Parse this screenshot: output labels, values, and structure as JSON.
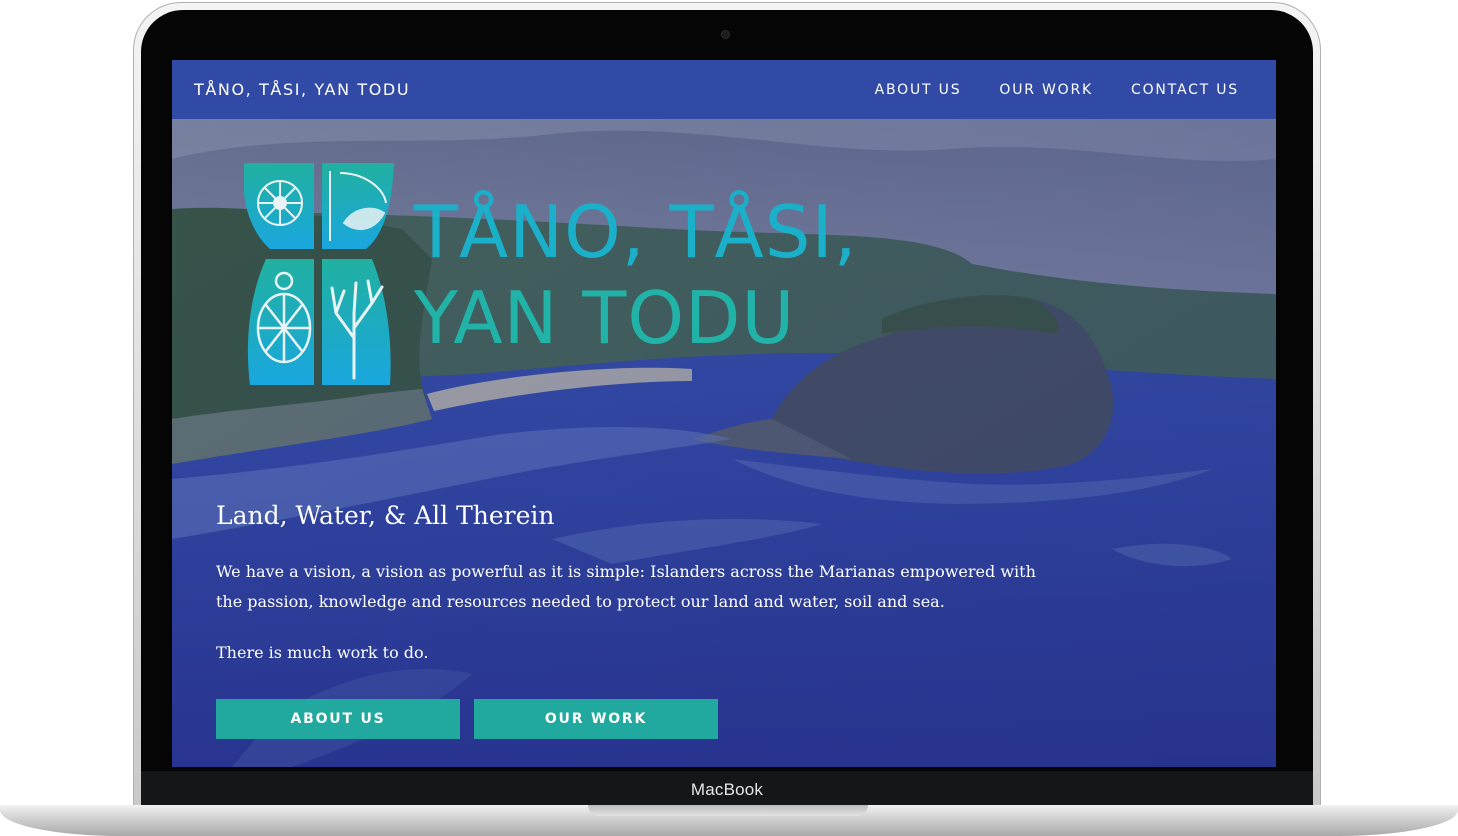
{
  "device": {
    "label": "MacBook"
  },
  "header": {
    "site_title": "TÅNO, TÅSI, YAN TODU",
    "nav": [
      {
        "label": "ABOUT US"
      },
      {
        "label": "OUR WORK"
      },
      {
        "label": "CONTACT US"
      }
    ]
  },
  "hero": {
    "logo_line1": "TÅNO, TÅSI,",
    "logo_line2": "YAN TODU",
    "tagline": "Land, Water, & All Therein",
    "vision": "We have a vision, a vision as powerful as it is simple: Islanders across the Marianas empowered with the passion, knowledge and resources needed to protect our land and water, soil and sea.",
    "work_text": "There is much work to do.",
    "buttons": [
      {
        "label": "ABOUT US"
      },
      {
        "label": "OUR WORK"
      }
    ]
  },
  "colors": {
    "nav_bar": "#314aa5",
    "button": "#21a9a0",
    "logo_teal": "#22b3a8",
    "logo_blue": "#1bb0c9"
  },
  "icons": [
    "hibiscus-icon",
    "shell-icon",
    "latte-stone-icon",
    "turtle-icon",
    "coral-icon"
  ]
}
